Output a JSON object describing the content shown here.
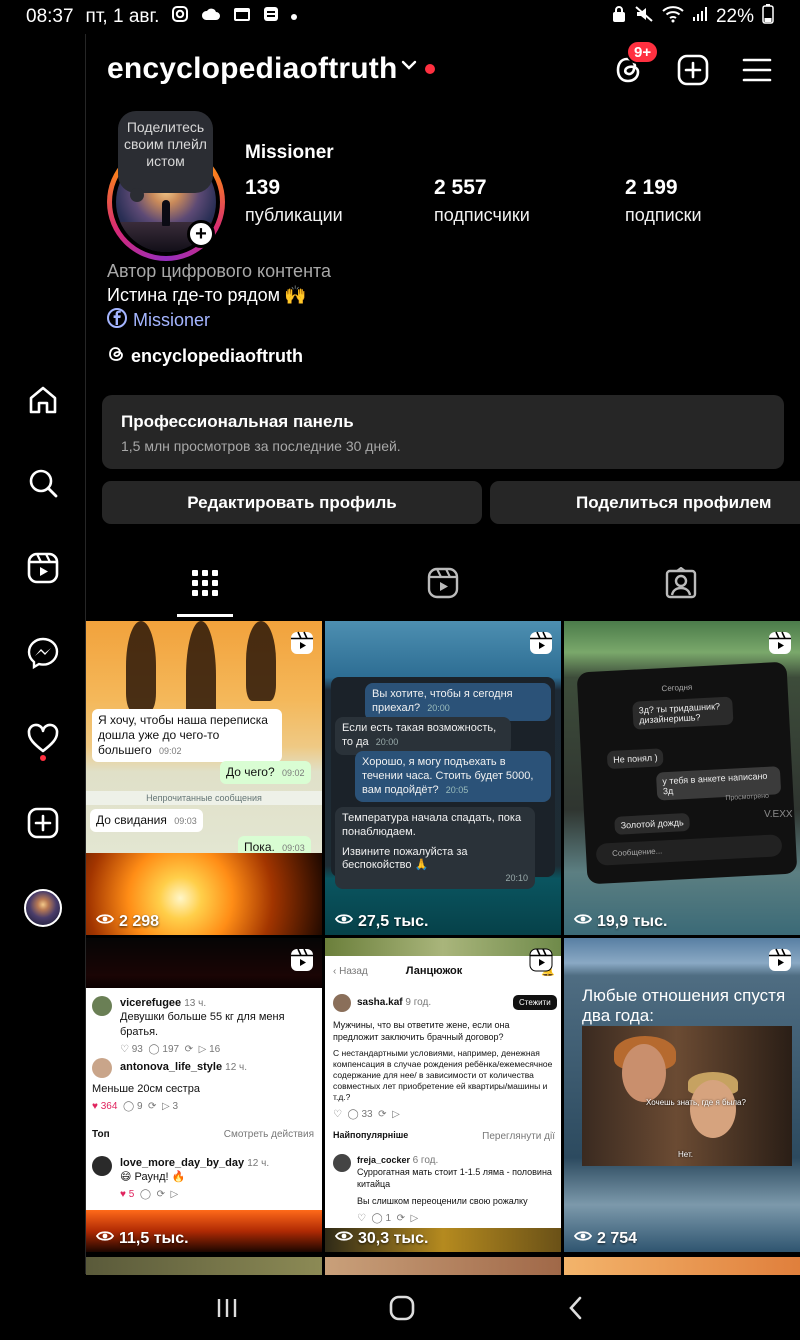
{
  "status_bar": {
    "time": "08:37",
    "date": "пт, 1 авг.",
    "battery": "22%",
    "icons": [
      "instagram-icon",
      "cloud-icon",
      "calendar-icon",
      "gallery-icon",
      "lock-icon",
      "mute-icon",
      "wifi-icon",
      "signal-icon",
      "battery-icon"
    ]
  },
  "header": {
    "username": "encyclopediaoftruth",
    "threads_badge": "9+",
    "icons": [
      "threads-icon",
      "create-icon",
      "menu-icon"
    ]
  },
  "rail": {
    "items": [
      "home-icon",
      "search-icon",
      "reels-icon",
      "messenger-icon",
      "heart-icon",
      "create-icon",
      "avatar"
    ]
  },
  "profile": {
    "note": "Поделитесь своим плейлистом",
    "display_name": "Missioner",
    "stats": [
      {
        "value": "139",
        "label": "публикации"
      },
      {
        "value": "2 557",
        "label": "подписчики"
      },
      {
        "value": "2 199",
        "label": "подписки"
      }
    ],
    "category": "Автор цифрового контента",
    "bio": "Истина где-то рядом",
    "bio_emoji": "🙌",
    "facebook_link": "Missioner",
    "threads_link": "encyclopediaoftruth"
  },
  "pro_panel": {
    "title": "Профессиональная панель",
    "subtitle": "1,5 млн просмотров за последние 30 дней."
  },
  "buttons": {
    "edit": "Редактировать профиль",
    "share": "Поделиться профилем"
  },
  "tabs": [
    "grid-icon",
    "reels-icon",
    "tagged-icon"
  ],
  "grid": {
    "tiles": [
      {
        "views": "2 298",
        "chat": {
          "msg1": "Я хочу, чтобы наша переписка дошла уже до чего-то большего",
          "t1": "09:02",
          "msg2": "До чего?",
          "t2": "09:02",
          "sep": "Непрочитанные сообщения",
          "msg3": "До свидания",
          "t3": "09:03",
          "msg4": "Пока.",
          "t4": "09:03"
        }
      },
      {
        "views": "27,5 тыс.",
        "chat": {
          "msg1": "Вы хотите, чтобы я сегодня приехал?",
          "t1": "20:00",
          "msg2": "Если есть такая возможность, то да",
          "t2": "20:00",
          "msg3": "Хорошо, я могу подъехать в течении часа. Стоить будет 5000, вам подойдёт?",
          "t3": "20:05",
          "msg4": "Температура начала спадать, пока понаблюдаем.",
          "msg5": "Извините пожалуйста за беспокойство 🙏",
          "t5": "20:10"
        }
      },
      {
        "views": "19,9 тыс.",
        "chat": {
          "today": "Сегодня",
          "msg1": "3д? ты тридашник? дизайнеришь?",
          "msg2": "Не понял )",
          "msg3": "у тебя в анкете написано 3д",
          "seen": "Просмотрено",
          "msg4": "Золотой дождь",
          "input": "Сообщение...",
          "watermark": "V.EXX"
        }
      },
      {
        "views": "11,5 тыс.",
        "thread": {
          "user1": "vicerefugee",
          "time1": "13 ч.",
          "text1": "Девушки больше 55 кг для меня братья.",
          "likes1": "93",
          "comments1": "197",
          "shares1": "16",
          "user2": "antonova_life_style",
          "time2": "12 ч.",
          "text2": "Меньше 20см сестра",
          "likes2": "364",
          "comments2": "9",
          "shares2": "3",
          "top_label": "Топ",
          "see_activity": "Смотреть действия",
          "user3": "love_more_day_by_day",
          "time3": "12 ч.",
          "text3": "😄 Раунд! 🔥",
          "likes3": "5"
        }
      },
      {
        "views": "30,3 тыс.",
        "thread": {
          "back": "Назад",
          "title": "Ланцюжок",
          "user1": "sasha.kaf",
          "time1": "9 год.",
          "follow": "Стежити",
          "text1": "Мужчины, что вы ответите жене, если она предложит заключить брачный договор?",
          "text1b": "С нестандартными условиями, например, денежная компенсация в случае рождения ребёнка/ежемесячное содержание для нее/ в зависимости от количества совместных лет приобретение ей квартиры/машины и т.д.?",
          "comments1": "33",
          "popular": "Найпопулярніше",
          "view_activity": "Переглянути дії",
          "user2": "freja_cocker",
          "time2": "6 год.",
          "text2": "Суррогатная мать стоит 1-1.5 ляма - половина китайца",
          "text3": "Вы слишком переоценили свою рожалку",
          "comments2": "1"
        }
      },
      {
        "views": "2 754",
        "caption": "Любые отношения спустя два года:",
        "sub1": "Хочешь знать, где я была?",
        "sub2": "Нет."
      }
    ]
  },
  "navbar": {
    "icons": [
      "recent-apps-icon",
      "home-button-icon",
      "back-icon"
    ]
  },
  "colors": {
    "background": "#000000",
    "panel": "#262626",
    "accent_red": "#ff3040",
    "link": "#a4b5ff",
    "muted": "#a8a8a8"
  }
}
